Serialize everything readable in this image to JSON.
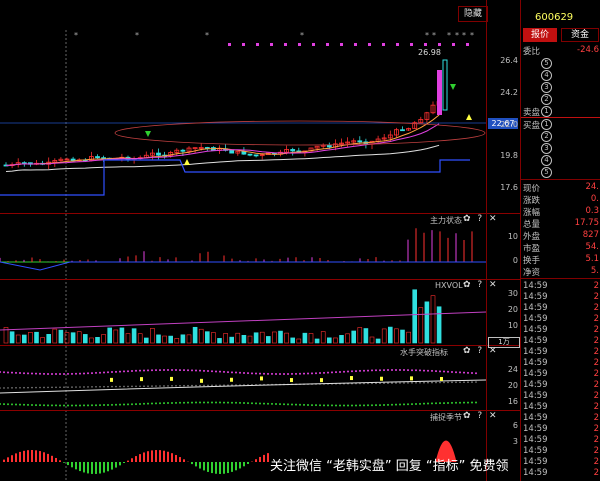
{
  "header": {
    "hide_label": "隐藏",
    "stock_code": "600629",
    "price_marker_high": "26.98",
    "price_tag_current": "22.67"
  },
  "y_axis_main": [
    "26.4",
    "24.2",
    "22.0",
    "19.8",
    "17.6"
  ],
  "indicators": [
    {
      "name": "主力状态",
      "ticks": [
        "10",
        "0"
      ]
    },
    {
      "name": "HXVOL",
      "ticks": [
        "30",
        "20",
        "10"
      ],
      "unit": "1万"
    },
    {
      "name": "水手突破指标",
      "ticks": [
        "24",
        "20",
        "16"
      ]
    },
    {
      "name": "捕捉季节",
      "ticks": [
        "6",
        "3"
      ]
    }
  ],
  "ind_controls": "✿ ? ✕",
  "right_panel": {
    "tabs": [
      "报价",
      "资金"
    ],
    "weibi_label": "委比",
    "weibi_value": "-24.6",
    "sell_label": "卖盘",
    "buy_label": "买盘",
    "circles": [
      "5",
      "4",
      "3",
      "2",
      "1",
      "1",
      "2",
      "3",
      "4",
      "5"
    ],
    "stats": [
      {
        "label": "现价",
        "value": "24."
      },
      {
        "label": "涨跌",
        "value": "0."
      },
      {
        "label": "涨幅",
        "value": "0.3"
      },
      {
        "label": "总量",
        "value": "17.75"
      },
      {
        "label": "外盘",
        "value": "827"
      },
      {
        "label": "市盈",
        "value": "54."
      },
      {
        "label": "换手",
        "value": "5.1"
      },
      {
        "label": "净资",
        "value": "5."
      }
    ],
    "ticks": [
      "14:59",
      "14:59",
      "14:59",
      "14:59",
      "14:59",
      "14:59",
      "14:59",
      "14:59",
      "14:59",
      "14:59",
      "14:59",
      "14:59",
      "14:59",
      "14:59",
      "14:59",
      "14:59",
      "14:59",
      "14:59"
    ]
  },
  "watermark": "关注微信 “老韩实盘” 回复 “指标” 免费领",
  "colors": {
    "up": "#ff3030",
    "down": "#30e0e0",
    "magenta": "#e040e0",
    "yellow": "#ffff40",
    "green": "#30d030",
    "blue": "#3050ff"
  }
}
